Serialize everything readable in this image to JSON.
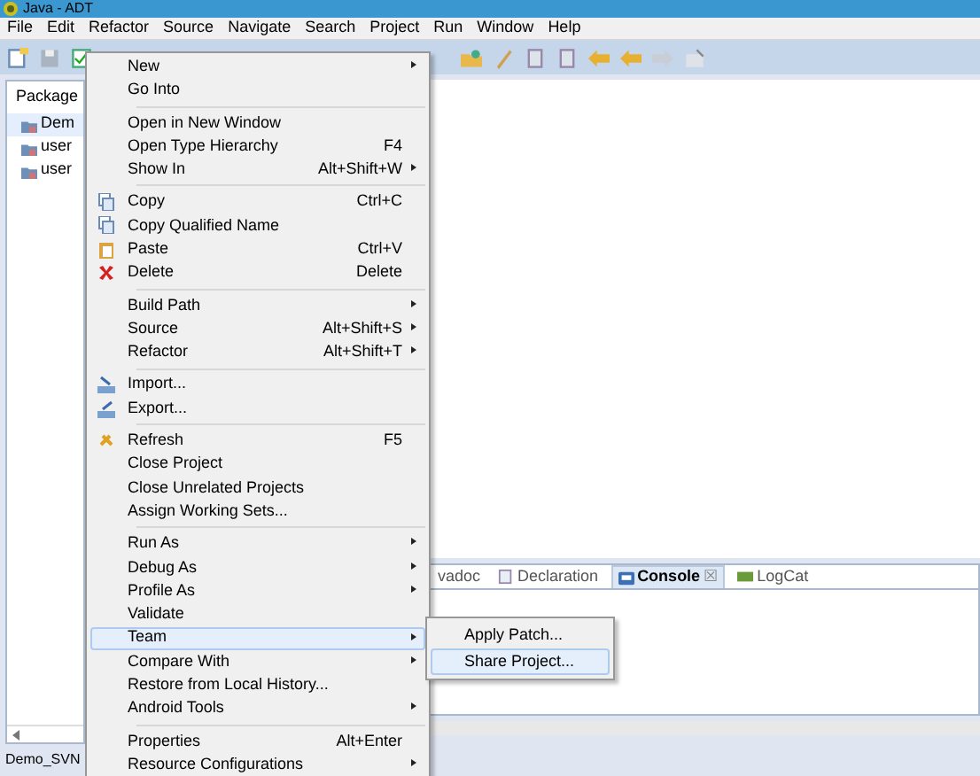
{
  "window": {
    "title": "Java - ADT"
  },
  "menubar": [
    "File",
    "Edit",
    "Refactor",
    "Source",
    "Navigate",
    "Search",
    "Project",
    "Run",
    "Window",
    "Help"
  ],
  "package_explorer": {
    "title": "Package",
    "items": [
      {
        "label": "Dem",
        "selected": true
      },
      {
        "label": "user",
        "selected": false
      },
      {
        "label": "user",
        "selected": false
      }
    ]
  },
  "view_tabs": [
    {
      "label": "vadoc",
      "selected": false
    },
    {
      "label": "Declaration",
      "selected": false
    },
    {
      "label": "Console",
      "selected": true,
      "close": "☒"
    },
    {
      "label": "LogCat",
      "selected": false
    }
  ],
  "context_menu": {
    "groups": [
      [
        {
          "label": "New",
          "submenu": true,
          "selected": false
        },
        {
          "label": "Go Into",
          "submenu": false,
          "selected": false
        }
      ],
      [
        {
          "label": "Open in New Window",
          "submenu": false,
          "selected": false
        },
        {
          "label": "Open Type Hierarchy",
          "shortcut": "F4",
          "submenu": false,
          "selected": false
        },
        {
          "label": "Show In",
          "shortcut": "Alt+Shift+W",
          "submenu": true,
          "selected": false
        }
      ],
      [
        {
          "label": "Copy",
          "shortcut": "Ctrl+C",
          "submenu": false,
          "selected": false
        },
        {
          "label": "Copy Qualified Name",
          "submenu": false,
          "selected": false
        },
        {
          "label": "Paste",
          "shortcut": "Ctrl+V",
          "submenu": false,
          "selected": false
        },
        {
          "label": "Delete",
          "shortcut": "Delete",
          "submenu": false,
          "selected": false
        }
      ],
      [
        {
          "label": "Build Path",
          "submenu": true,
          "selected": false
        },
        {
          "label": "Source",
          "shortcut": "Alt+Shift+S",
          "submenu": true,
          "selected": false
        },
        {
          "label": "Refactor",
          "shortcut": "Alt+Shift+T",
          "submenu": true,
          "selected": false
        }
      ],
      [
        {
          "label": "Import...",
          "submenu": false,
          "selected": false
        },
        {
          "label": "Export...",
          "submenu": false,
          "selected": false
        }
      ],
      [
        {
          "label": "Refresh",
          "shortcut": "F5",
          "submenu": false,
          "selected": false
        },
        {
          "label": "Close Project",
          "submenu": false,
          "selected": false
        },
        {
          "label": "Close Unrelated Projects",
          "submenu": false,
          "selected": false
        },
        {
          "label": "Assign Working Sets...",
          "submenu": false,
          "selected": false
        }
      ],
      [
        {
          "label": "Run As",
          "submenu": true,
          "selected": false
        },
        {
          "label": "Debug As",
          "submenu": true,
          "selected": false
        },
        {
          "label": "Profile As",
          "submenu": true,
          "selected": false
        },
        {
          "label": "Validate",
          "submenu": false,
          "selected": false
        },
        {
          "label": "Team",
          "submenu": true,
          "selected": true
        },
        {
          "label": "Compare With",
          "submenu": true,
          "selected": false
        },
        {
          "label": "Restore from Local History...",
          "submenu": false,
          "selected": false
        },
        {
          "label": "Android Tools",
          "submenu": true,
          "selected": false
        }
      ],
      [
        {
          "label": "Properties",
          "shortcut": "Alt+Enter",
          "submenu": false,
          "selected": false
        },
        {
          "label": "Resource Configurations",
          "submenu": true,
          "selected": false
        }
      ]
    ]
  },
  "team_submenu": [
    {
      "label": "Apply Patch...",
      "selected": false
    },
    {
      "label": "Share Project...",
      "selected": true
    }
  ],
  "status_bar": "Demo_SVN"
}
